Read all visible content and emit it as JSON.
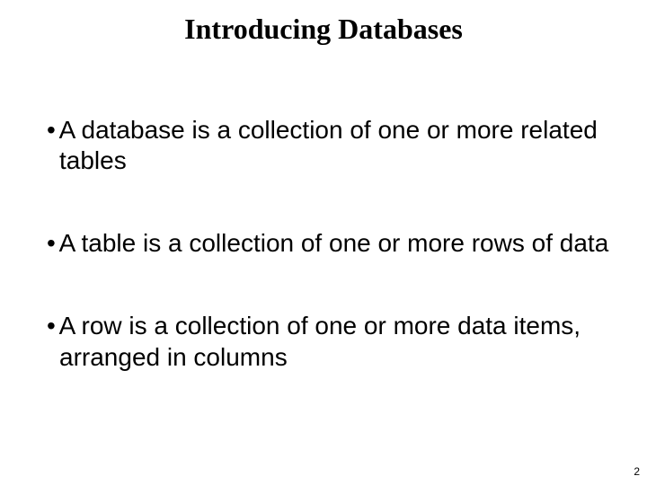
{
  "slide": {
    "title": "Introducing Databases",
    "bullets": [
      "A database is a collection of one or more related tables",
      "A table is a collection of one or more rows of data",
      "A row is a collection of one or more data items, arranged in columns"
    ],
    "page_number": "2"
  }
}
